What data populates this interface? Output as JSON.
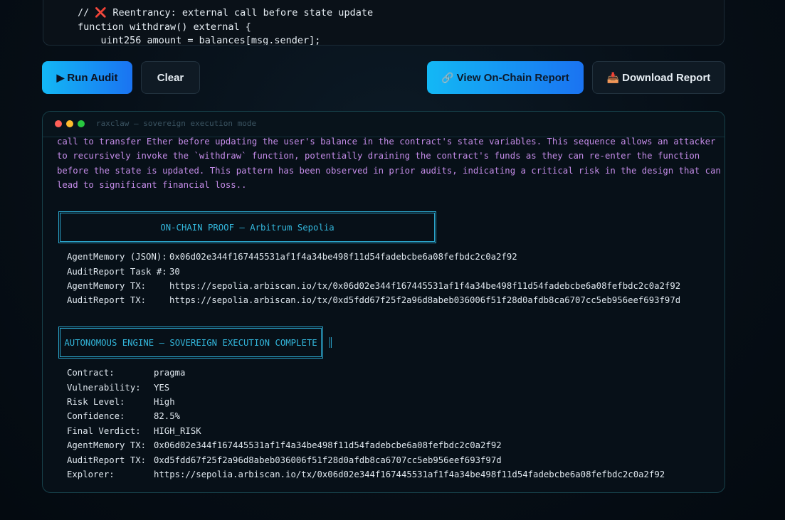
{
  "code": {
    "lines": [
      {
        "cross": "❌",
        "text": " Reentrancy: external call before state update",
        "prefix": "// "
      },
      {
        "text": "function withdraw() external {"
      },
      {
        "text": "    uint256 amount = balances[msg.sender];"
      }
    ]
  },
  "toolbar": {
    "run_label": "Run Audit",
    "run_icon": "▶",
    "clear_label": "Clear",
    "view_label": "View On-Chain Report",
    "view_icon": "🔗",
    "download_label": "Download Report",
    "download_icon": "📥"
  },
  "terminal": {
    "title": "raxclaw — sovereign execution mode",
    "analysis_lines": [
      "call to transfer Ether before updating the user's balance in the contract's state variables. This sequence allows an attacker",
      "to recursively invoke the `withdraw` function, potentially draining the contract's funds as they can re-enter the function",
      "before the state is updated. This pattern has been observed in prior audits, indicating a critical risk in the design that can",
      "lead to significant financial loss.."
    ],
    "proof_box_title": "ON-CHAIN PROOF — Arbitrum Sepolia",
    "proof_rows": [
      {
        "key": "AgentMemory (JSON):",
        "value": "0x06d02e344f167445531af1f4a34be498f11d54fadebcbe6a08fefbdc2c0a2f92"
      },
      {
        "key": "AuditReport Task #:",
        "value": "30"
      },
      {
        "key": "AgentMemory TX:",
        "value": "https://sepolia.arbiscan.io/tx/0x06d02e344f167445531af1f4a34be498f11d54fadebcbe6a08fefbdc2c0a2f92"
      },
      {
        "key": "AuditReport TX:",
        "value": "https://sepolia.arbiscan.io/tx/0xd5fdd67f25f2a96d8abeb036006f51f28d0afdb8ca6707cc5eb956eef693f97d"
      }
    ],
    "engine_box_title": "AUTONOMOUS ENGINE — SOVEREIGN EXECUTION COMPLETE",
    "engine_rows": [
      {
        "key": "Contract:",
        "value": "pragma"
      },
      {
        "key": "Vulnerability:",
        "value": "YES"
      },
      {
        "key": "Risk Level:",
        "value": "High"
      },
      {
        "key": "Confidence:",
        "value": "82.5%"
      },
      {
        "key": "Final Verdict:",
        "value": "HIGH_RISK"
      },
      {
        "key": "AgentMemory TX:",
        "value": "0x06d02e344f167445531af1f4a34be498f11d54fadebcbe6a08fefbdc2c0a2f92"
      },
      {
        "key": "AuditReport TX:",
        "value": "0xd5fdd67f25f2a96d8abeb036006f51f28d0afdb8ca6707cc5eb956eef693f97d"
      },
      {
        "key": "Explorer:",
        "value": "https://sepolia.arbiscan.io/tx/0x06d02e344f167445531af1f4a34be498f11d54fadebcbe6a08fefbdc2c0a2f92"
      }
    ]
  },
  "colors": {
    "accent": "#13b8f5",
    "analysis_text": "#c48ce8",
    "box_border": "#2aa3c9"
  }
}
